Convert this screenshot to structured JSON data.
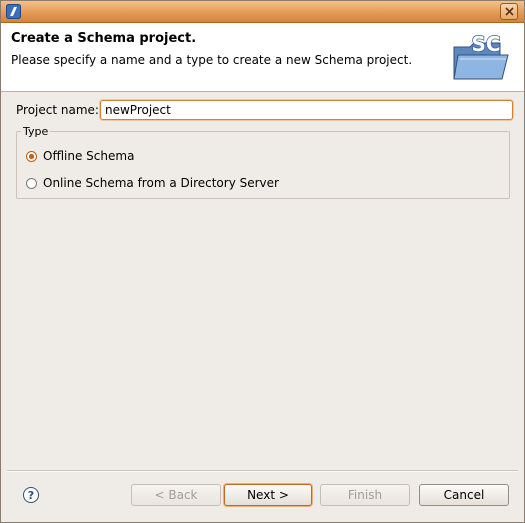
{
  "window": {
    "title": ""
  },
  "banner": {
    "title": "Create a Schema project.",
    "description": "Please specify a name and a type to create a new Schema project.",
    "logo_text": "SC"
  },
  "form": {
    "project_name_label": "Project name:",
    "project_name_value": "newProject",
    "type_group_label": "Type",
    "options": [
      {
        "label": "Offline Schema",
        "checked": true
      },
      {
        "label": "Online Schema from a Directory Server",
        "checked": false
      }
    ]
  },
  "buttons": {
    "back": "< Back",
    "next": "Next >",
    "finish": "Finish",
    "cancel": "Cancel"
  },
  "colors": {
    "accent": "#d08236",
    "titlebar": "#e49b55"
  }
}
